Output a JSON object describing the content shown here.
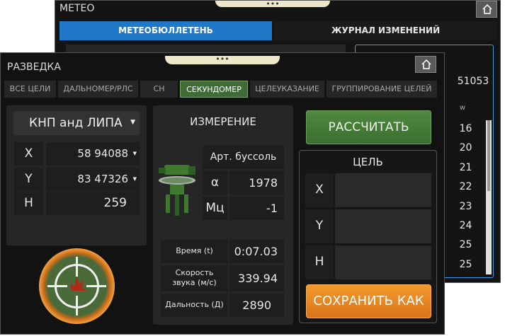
{
  "meteo": {
    "title": "МЕТЕО",
    "tabs": [
      "МЕТЕОБЮЛЛЕТЕНЬ",
      "ЖУРНАЛ ИЗМЕНЕНИЙ"
    ],
    "header_value": "51053",
    "col_header": "w",
    "rows": [
      "16",
      "20",
      "21",
      "22",
      "23",
      "24",
      "25",
      "25"
    ]
  },
  "razv": {
    "title": "РАЗВЕДКА",
    "tabs": [
      "ВСЕ ЦЕЛИ",
      "ДАЛЬНОМЕР/РЛС",
      "СН",
      "СЕКУНДОМЕР",
      "ЦЕЛЕУКАЗАНИЕ",
      "ГРУППИРОВАНИЕ ЦЕЛЕЙ"
    ],
    "active_tab": "СЕКУНДОМЕР",
    "knp": {
      "select": "КНП анд ЛИПА",
      "x_label": "X",
      "x_value": "58 94088",
      "y_label": "Y",
      "y_value": "83 47326",
      "h_label": "H",
      "h_value": "259"
    },
    "measure": {
      "title": "ИЗМЕРЕНИЕ",
      "device": "Арт. буссоль",
      "alpha_label": "α",
      "alpha_value": "1978",
      "mc_label": "Мц",
      "mc_value": "-1",
      "time_label": "Время (t)",
      "time_value": "0:07.03",
      "speed_label": "Скорость звука (м/с)",
      "speed_value": "339.94",
      "dist_label": "Дальность (Д)",
      "dist_value": "2890"
    },
    "calc_button": "РАССЧИТАТЬ",
    "target": {
      "title": "ЦЕЛЬ",
      "x_label": "X",
      "y_label": "Y",
      "h_label": "H"
    },
    "save_button": "СОХРАНИТЬ КАК"
  },
  "colors": {
    "accent_blue": "#1e78c8",
    "active_tab_green": "#3e6b36",
    "orange": "#e8861f",
    "green_button": "#4a8a3a"
  },
  "icons": [
    "home-icon",
    "dropdown-arrow-icon",
    "theodolite-icon",
    "target-crosshair-icon"
  ]
}
